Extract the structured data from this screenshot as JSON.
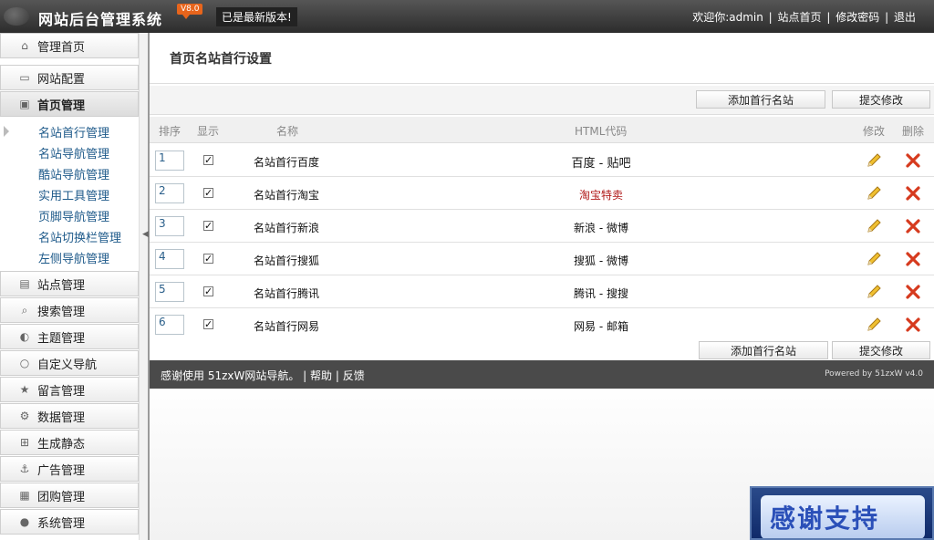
{
  "header": {
    "title": "网站后台管理系统",
    "version": "V8.0",
    "latest": "已是最新版本!",
    "nav": {
      "welcome": "欢迎你:admin",
      "sep1": "|",
      "home": "站点首页",
      "sep2": "|",
      "password": "修改密码",
      "sep3": "|",
      "logout": "退出"
    }
  },
  "sidebar": {
    "items": [
      {
        "label": "管理首页",
        "icon": "house-icon"
      },
      {
        "label": "网站配置",
        "icon": "book-icon"
      },
      {
        "label": "首页管理",
        "icon": "monitor-icon"
      },
      {
        "label": "站点管理",
        "icon": "tv-icon"
      },
      {
        "label": "搜索管理",
        "icon": "search-icon"
      },
      {
        "label": "主题管理",
        "icon": "brush-icon"
      },
      {
        "label": "自定义导航",
        "icon": "lightbulb-icon"
      },
      {
        "label": "留言管理",
        "icon": "star-icon"
      },
      {
        "label": "数据管理",
        "icon": "gear-icon"
      },
      {
        "label": "生成静态",
        "icon": "plus-box-icon"
      },
      {
        "label": "广告管理",
        "icon": "anchor-icon"
      },
      {
        "label": "团购管理",
        "icon": "calendar-icon"
      },
      {
        "label": "系统管理",
        "icon": "user-icon"
      }
    ],
    "submenu": [
      {
        "label": "名站首行管理"
      },
      {
        "label": "名站导航管理"
      },
      {
        "label": "酷站导航管理"
      },
      {
        "label": "实用工具管理"
      },
      {
        "label": "页脚导航管理"
      },
      {
        "label": "名站切换栏管理"
      },
      {
        "label": "左侧导航管理"
      }
    ]
  },
  "main": {
    "title": "首页名站首行设置",
    "buttons": {
      "add": "添加首行名站",
      "submit": "提交修改"
    },
    "columns": {
      "sort": "排序",
      "show": "显示",
      "name": "名称",
      "html": "HTML代码",
      "edit": "修改",
      "delete": "删除"
    },
    "rows": [
      {
        "sort": "1",
        "checked": "✓",
        "name": "名站首行百度",
        "html": "百度 - 贴吧",
        "style": "big"
      },
      {
        "sort": "2",
        "checked": "✓",
        "name": "名站首行淘宝",
        "html": "淘宝特卖",
        "style": "red"
      },
      {
        "sort": "3",
        "checked": "✓",
        "name": "名站首行新浪",
        "html": "新浪 - 微博",
        "style": ""
      },
      {
        "sort": "4",
        "checked": "✓",
        "name": "名站首行搜狐",
        "html": "搜狐 - 微博",
        "style": ""
      },
      {
        "sort": "5",
        "checked": "✓",
        "name": "名站首行腾讯",
        "html": "腾讯 - 搜搜",
        "style": ""
      },
      {
        "sort": "6",
        "checked": "✓",
        "name": "名站首行网易",
        "html": "网易 - 邮箱",
        "style": ""
      }
    ]
  },
  "footer": {
    "thanks": "感谢使用  51zxW网站导航。 | 帮助 | 反馈",
    "powered": "Powered by 51zxW v4.0"
  },
  "banner": {
    "text": "感谢支持"
  }
}
